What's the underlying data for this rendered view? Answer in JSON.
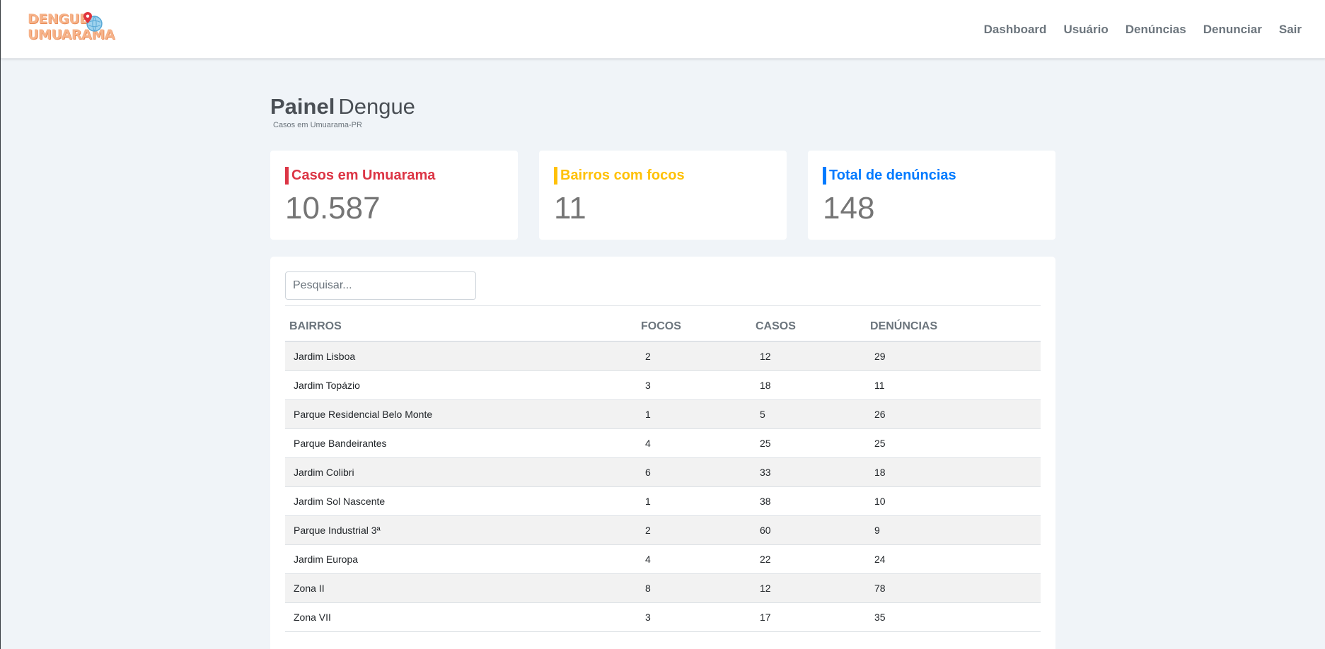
{
  "brand": {
    "logo_line1": "DENGUE",
    "logo_line2": "UMUARAMA"
  },
  "nav": [
    "Dashboard",
    "Usuário",
    "Denúncias",
    "Denunciar",
    "Sair"
  ],
  "page": {
    "title_bold": "Painel",
    "title_rest": "Dengue",
    "subtitle": "Casos em Umuarama-PR"
  },
  "cards": [
    {
      "label": "Casos em Umuarama",
      "value": "10.587",
      "color": "#dc3545"
    },
    {
      "label": "Bairros com focos",
      "value": "11",
      "color": "#ffc107"
    },
    {
      "label": "Total de denúncias",
      "value": "148",
      "color": "#007bff"
    }
  ],
  "search": {
    "placeholder": "Pesquisar..."
  },
  "table": {
    "headers": [
      "BAIRROS",
      "FOCOS",
      "CASOS",
      "DENÚNCIAS"
    ],
    "rows": [
      [
        "Jardim Lisboa",
        "2",
        "12",
        "29"
      ],
      [
        "Jardim Topázio",
        "3",
        "18",
        "11"
      ],
      [
        "Parque Residencial Belo Monte",
        "1",
        "5",
        "26"
      ],
      [
        "Parque Bandeirantes",
        "4",
        "25",
        "25"
      ],
      [
        "Jardim Colibri",
        "6",
        "33",
        "18"
      ],
      [
        "Jardim Sol Nascente",
        "1",
        "38",
        "10"
      ],
      [
        "Parque Industrial 3ª",
        "2",
        "60",
        "9"
      ],
      [
        "Jardim Europa",
        "4",
        "22",
        "24"
      ],
      [
        "Zona II",
        "8",
        "12",
        "78"
      ],
      [
        "Zona VII",
        "3",
        "17",
        "35"
      ]
    ]
  }
}
